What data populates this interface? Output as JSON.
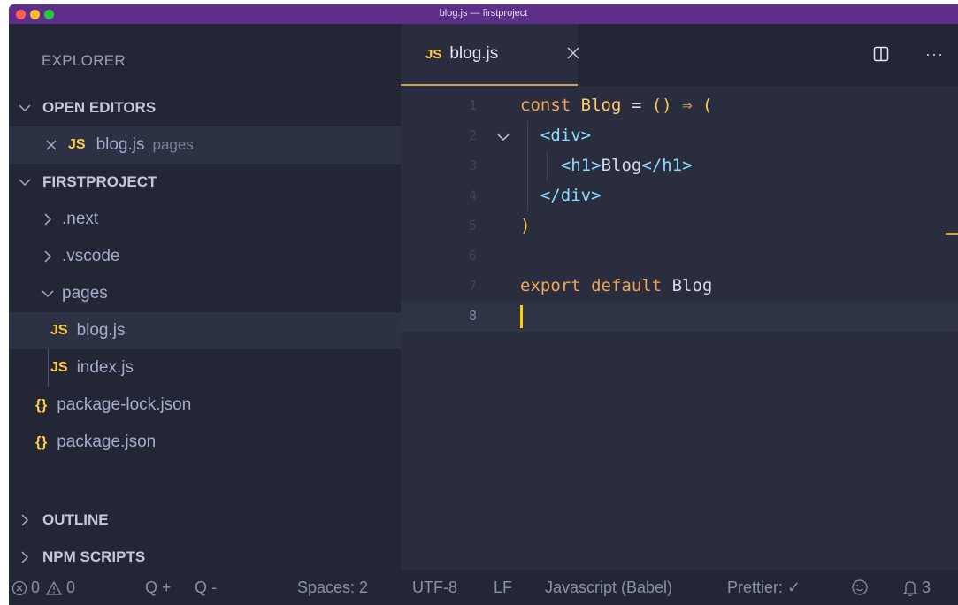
{
  "window": {
    "title": "blog.js — firstproject",
    "colors": {
      "titlebar": "#5e2f8a",
      "sidebar": "#232635",
      "editor": "#292d3e",
      "accent": "#c9a453",
      "js_badge": "#ffcb45"
    }
  },
  "sidebar": {
    "header": "EXPLORER",
    "open_editors": {
      "label": "OPEN EDITORS",
      "items": [
        {
          "badge": "JS",
          "name": "blog.js",
          "folder": "pages"
        }
      ]
    },
    "project": {
      "label": "FIRSTPROJECT",
      "items": [
        {
          "name": ".next",
          "kind": "folder"
        },
        {
          "name": ".vscode",
          "kind": "folder"
        },
        {
          "name": "pages",
          "kind": "folder-open"
        },
        {
          "badge": "JS",
          "name": "blog.js",
          "kind": "file"
        },
        {
          "badge": "JS",
          "name": "index.js",
          "kind": "file"
        },
        {
          "badge": "{}",
          "name": "package-lock.json",
          "kind": "file"
        },
        {
          "badge": "{}",
          "name": "package.json",
          "kind": "file"
        }
      ]
    },
    "outline_label": "OUTLINE",
    "npm_scripts_label": "NPM SCRIPTS"
  },
  "editor": {
    "tab": {
      "badge": "JS",
      "label": "blog.js"
    },
    "lines": [
      {
        "num": "1",
        "tokens": [
          {
            "c": "k",
            "t": "const "
          },
          {
            "c": "n",
            "t": "Blog"
          },
          {
            "c": "",
            "t": " = "
          },
          {
            "c": "y",
            "t": "()"
          },
          {
            "c": "",
            "t": " "
          },
          {
            "c": "k",
            "t": "⇒"
          },
          {
            "c": "",
            "t": " "
          },
          {
            "c": "y",
            "t": "("
          }
        ]
      },
      {
        "num": "2",
        "tokens": [
          {
            "c": "",
            "t": "  "
          },
          {
            "c": "p",
            "t": "<"
          },
          {
            "c": "t",
            "t": "div"
          },
          {
            "c": "p",
            "t": ">"
          }
        ]
      },
      {
        "num": "3",
        "tokens": [
          {
            "c": "",
            "t": "    "
          },
          {
            "c": "p",
            "t": "<"
          },
          {
            "c": "t",
            "t": "h1"
          },
          {
            "c": "p",
            "t": ">"
          },
          {
            "c": "",
            "t": "Blog"
          },
          {
            "c": "p",
            "t": "</"
          },
          {
            "c": "t",
            "t": "h1"
          },
          {
            "c": "p",
            "t": ">"
          }
        ]
      },
      {
        "num": "4",
        "tokens": [
          {
            "c": "",
            "t": "  "
          },
          {
            "c": "p",
            "t": "</"
          },
          {
            "c": "t",
            "t": "div"
          },
          {
            "c": "p",
            "t": ">"
          }
        ]
      },
      {
        "num": "5",
        "tokens": [
          {
            "c": "y",
            "t": ")"
          }
        ]
      },
      {
        "num": "6",
        "tokens": []
      },
      {
        "num": "7",
        "tokens": [
          {
            "c": "k",
            "t": "export "
          },
          {
            "c": "k",
            "t": "default "
          },
          {
            "c": "",
            "t": "Blog"
          }
        ]
      },
      {
        "num": "8",
        "tokens": []
      }
    ]
  },
  "status": {
    "errors": "0",
    "warnings": "0",
    "zoom_in": "Q +",
    "zoom_out": "Q -",
    "spaces": "Spaces: 2",
    "encoding": "UTF-8",
    "eol": "LF",
    "language": "Javascript (Babel)",
    "prettier": "Prettier: ✓",
    "notifications": "3"
  }
}
